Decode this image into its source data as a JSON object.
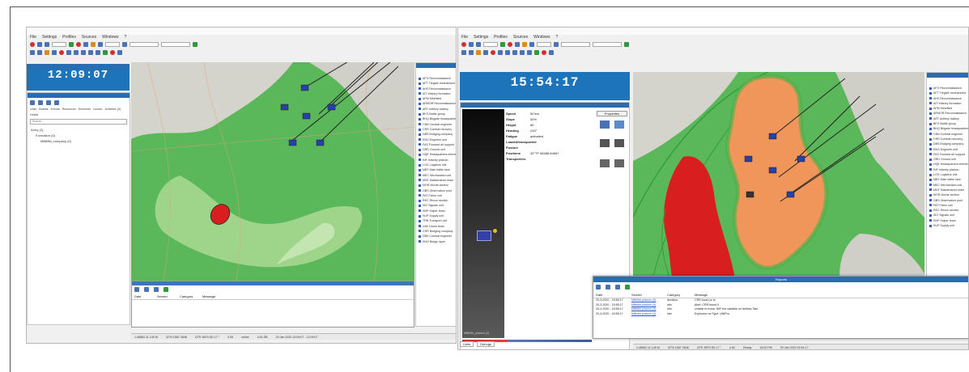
{
  "left": {
    "clock_time": "12:09:07",
    "menu": [
      "File",
      "Settings",
      "Profiles",
      "Sources",
      "Windows",
      "?"
    ],
    "tree": [
      "Army (2)",
      "Formation (0)",
      "MBtMkt_company (0)"
    ],
    "tree_tabs": [
      "Units",
      "Boards",
      "Events",
      "Resources",
      "Elements",
      "Launch",
      "Activities (0)",
      "Hotels"
    ],
    "search_placeholder": "Search",
    "log_columns": [
      "Date",
      "Sender",
      "Category",
      "Message"
    ],
    "status": [
      "1:48562.11 149 M",
      "32°N 1587 2846",
      "22°E 8579 SD 17 °",
      "3.05",
      "online",
      "4.61 DB",
      "20 Jan 2020 12:09:07 - 12:09:07"
    ]
  },
  "right": {
    "clock_time": "15:54:17",
    "menu": [
      "File",
      "Settings",
      "Profiles",
      "Sources",
      "Windows",
      "?"
    ],
    "properties": [
      {
        "k": "Speed",
        "v": "50 km"
      },
      {
        "k": "Slope",
        "v": "50%"
      },
      {
        "k": "Height",
        "v": "80"
      },
      {
        "k": "Heading",
        "v": "245°"
      },
      {
        "k": "Fatigue",
        "v": "activated"
      },
      {
        "k": "Loaded/transported",
        "v": "--"
      },
      {
        "k": "Posture",
        "v": ""
      },
      {
        "k": "Positions",
        "v": "32°TF 98488 84667"
      },
      {
        "k": "Transporters",
        "v": ""
      }
    ],
    "properties_button": "Properties",
    "unit_label": "MBtMkt_platoon (2)",
    "log_title": "Reports",
    "log_columns": [
      "Date",
      "Sender",
      "Category",
      "Message"
    ],
    "log_rows": [
      {
        "date": "20-3-2020 - 15:55:17",
        "sender": "MBtMkt platoon (3)",
        "cat": "decision",
        "msg": "CRR-local (or to"
      },
      {
        "date": "20-3-2020 - 15:55:17",
        "sender": "MBtMkt platoon (3)",
        "cat": "info",
        "msg": "Alert: CRR found 0"
      },
      {
        "date": "20-3-2020 - 15:55:17",
        "sender": "MBtMkt platoon (3)",
        "cat": "info",
        "msg": "Unable to move: 80F the variable on defines Taut"
      },
      {
        "date": "20-3-2020 - 15:55:17",
        "sender": "MBtMkt platoon (3)",
        "cat": "info",
        "msg": "Explosion on Type: VidiPro"
      }
    ],
    "bottom_tabs": [
      "Units",
      "Debugs"
    ],
    "status": [
      "1:48562.11 149 M",
      "32°N 1587 2846",
      "22°E 8579 SD 17 °",
      "4.62",
      "Ready",
      "15:00 PM",
      "20 Jan 2020 15:54:17"
    ]
  },
  "legend_items": [
    "AFG Reconnaissance",
    "AFT Tregale mechanized",
    "AHS Reconnaissance",
    "AIT Infantry formation",
    "APM Minefield",
    "ARMOR Reconnaissance",
    "ART Artillery battery",
    "BFG Battle group",
    "BHQ Brigade headquarters",
    "CBN Combat engineer",
    "CRR Combat recovery",
    "DBS Bridging company",
    "ENG Engineer unit",
    "FAS Forward air support",
    "GRD Ground unit",
    "HQE Headquarters element",
    "INF Infantry platoon",
    "LOG Logistics unit",
    "MBT Main battle tank",
    "MEC Mechanized unit",
    "MNT Maintenance team",
    "MOR Mortar section",
    "OBS Observation post",
    "PAT Patrol unit",
    "REC Recon section",
    "SIG Signals unit",
    "SNP Sniper team",
    "SUP Supply unit",
    "TRN Transport unit",
    "UAV Drone team",
    "CRR Bridging company",
    "DBS Combat engineer",
    "ENG Bridge layer"
  ],
  "colors": {
    "clock": "#1e74b8",
    "map_green": "#5bb85a",
    "map_light": "#9ed58a",
    "zone_orange": "#f0965a",
    "zone_red": "#d81e1e",
    "unit_blue": "#2840a8"
  }
}
